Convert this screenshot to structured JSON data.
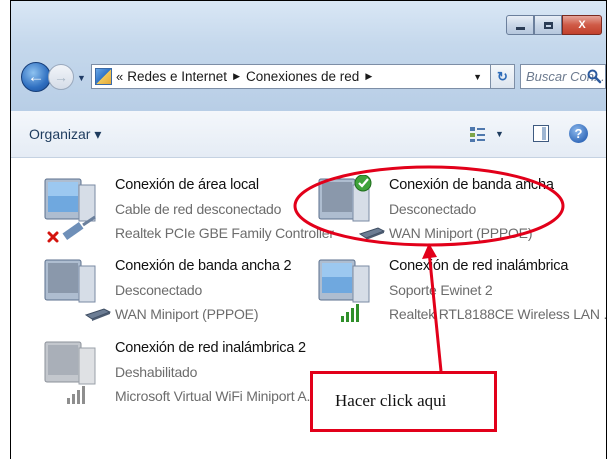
{
  "window": {
    "minimize_glyph": "min-glyph",
    "maximize_glyph": "max-glyph",
    "close_label": "X"
  },
  "nav": {
    "back_label": "←",
    "forward_label": "→",
    "recent_label": "▼"
  },
  "address": {
    "prefix": "«",
    "crumbs": [
      "Redes e Internet",
      "Conexiones de red"
    ],
    "crumb_separator": "▶",
    "dropdown_label": "▼",
    "refresh_label": "↻"
  },
  "search": {
    "placeholder": "Buscar Con..."
  },
  "toolbar": {
    "organize_label": "Organizar ▾",
    "views_arrow": "▼",
    "help_label": "?"
  },
  "connections": [
    {
      "name": "Conexión de área local",
      "status": "Cable de red desconectado",
      "device": "Realtek PCIe GBE Family Controller",
      "icon": "ethernet-disconnected-icon"
    },
    {
      "name": "Conexión de banda ancha",
      "status": "Desconectado",
      "device": "WAN Miniport (PPPOE)",
      "icon": "broadband-default-icon"
    },
    {
      "name": "Conexión de banda ancha 2",
      "status": "Desconectado",
      "device": "WAN Miniport (PPPOE)",
      "icon": "broadband-icon"
    },
    {
      "name": "Conexión de red inalámbrica",
      "status": "Soporte Ewinet  2",
      "device": "Realtek RTL8188CE Wireless LAN ...",
      "icon": "wireless-icon"
    },
    {
      "name": "Conexión de red inalámbrica 2",
      "status": "Deshabilitado",
      "device": "Microsoft Virtual WiFi Miniport A...",
      "icon": "wireless-disabled-icon"
    }
  ],
  "annotation": {
    "callout_text": "Hacer click aqui",
    "color": "#e2001a"
  },
  "colors": {
    "title_gradient_top": "#d9e7f5",
    "toolbar_text": "#1e3b5e",
    "secondary_text": "#6c6c6c"
  }
}
